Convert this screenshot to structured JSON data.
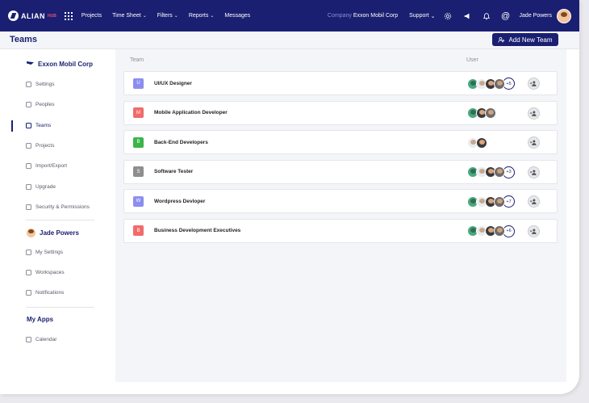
{
  "app": {
    "logo_text": "ALIAN",
    "logo_sub": "HUB",
    "nav": [
      {
        "label": "Projects",
        "has_caret": false
      },
      {
        "label": "Time Sheet",
        "has_caret": true
      },
      {
        "label": "Filters",
        "has_caret": true
      },
      {
        "label": "Reports",
        "has_caret": true
      },
      {
        "label": "Messages",
        "has_caret": false
      }
    ],
    "company_label": "Company",
    "company_name": "Exxon Mobil Corp",
    "support_label": "Support",
    "user_name": "Jade Powers"
  },
  "header": {
    "title": "Teams",
    "add_button_label": "Add New Team"
  },
  "sidebar": {
    "org_name": "Exxon Mobil Corp",
    "org_items": [
      "Settings",
      "Peoples",
      "Teams",
      "Projects",
      "Import/Export",
      "Upgrade",
      "Security & Permissions"
    ],
    "active_item": "Teams",
    "user_name": "Jade Powers",
    "user_items": [
      "My Settings",
      "Workspaces",
      "Notifications"
    ],
    "apps_title": "My Apps",
    "apps_items": [
      "Calendar"
    ]
  },
  "table": {
    "columns": [
      "Team",
      "User"
    ],
    "rows": [
      {
        "initial": "U",
        "name": "UI/UX Designer",
        "color": "#8b8ef0",
        "avatars": [
          "a1",
          "a2",
          "a3",
          "a4"
        ],
        "more": "+5"
      },
      {
        "initial": "M",
        "name": "Mobile Application Developer",
        "color": "#f26b6b",
        "avatars": [
          "a1",
          "a3",
          "a4"
        ],
        "more": ""
      },
      {
        "initial": "B",
        "name": "Back-End Developers",
        "color": "#3bb54a",
        "avatars": [
          "a2",
          "a3"
        ],
        "more": ""
      },
      {
        "initial": "S",
        "name": "Software Tester",
        "color": "#8e8e8e",
        "avatars": [
          "a1",
          "a2",
          "a3",
          "a4"
        ],
        "more": "+3"
      },
      {
        "initial": "W",
        "name": "Wordpress Devloper",
        "color": "#8b8ef0",
        "avatars": [
          "a1",
          "a2",
          "a3",
          "a4"
        ],
        "more": "+7"
      },
      {
        "initial": "B",
        "name": "Business Development Executives",
        "color": "#f26b6b",
        "avatars": [
          "a1",
          "a2",
          "a3",
          "a4"
        ],
        "more": "+6"
      }
    ]
  },
  "colors": {
    "brand": "#1a1f71",
    "accent": "#e4517b"
  }
}
